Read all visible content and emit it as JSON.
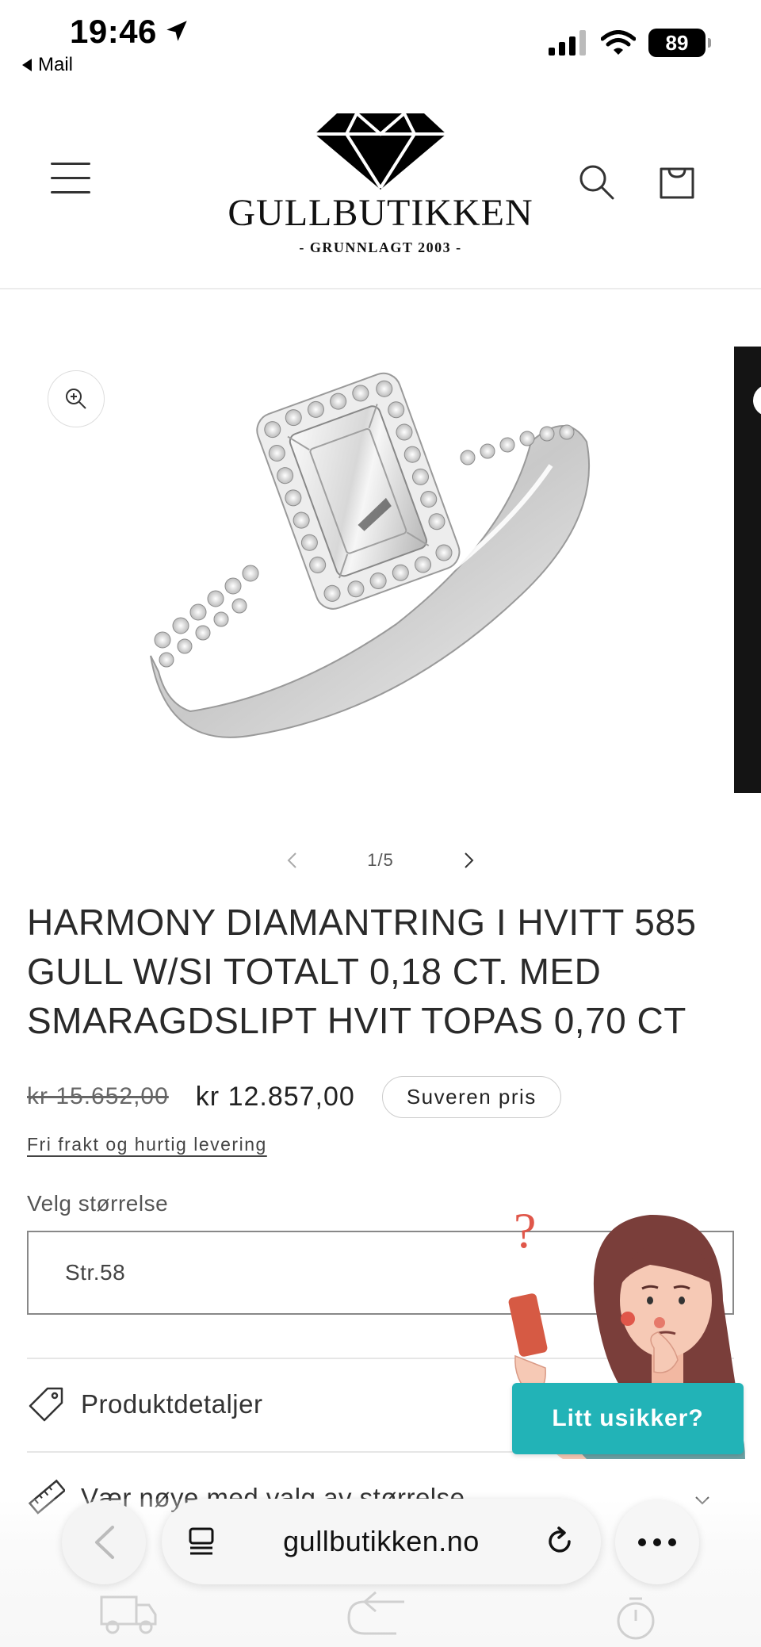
{
  "status_bar": {
    "time": "19:46",
    "back_app": "Mail",
    "battery": "89"
  },
  "header": {
    "logo_name": "GULLBUTIKKEN",
    "logo_tagline": "- GRUNNLAGT 2003 -"
  },
  "gallery": {
    "counter": "1/5"
  },
  "product": {
    "title": "HARMONY DIAMANTRING I HVITT 585 GULL W/SI TOTALT 0,18 CT. MED SMARAGDSLIPT HVIT TOPAS 0,70 CT",
    "price_old": "kr 15.652,00",
    "price_new": "kr 12.857,00",
    "badge": "Suveren pris",
    "shipping_link": "Fri frakt og hurtig levering",
    "size_label": "Velg størrelse",
    "size_value": "Str.58"
  },
  "accordion": [
    {
      "label": "Produktdetaljer",
      "icon": "tag-icon"
    },
    {
      "label": "Vær nøye med valg av størrelse",
      "icon": "ruler-icon"
    }
  ],
  "help_widget": {
    "button_label": "Litt usikker?",
    "question_mark": "?"
  },
  "browser": {
    "url": "gullbutikken.no"
  },
  "colors": {
    "help_button": "#22b3b7",
    "text": "#2a2a2a"
  }
}
